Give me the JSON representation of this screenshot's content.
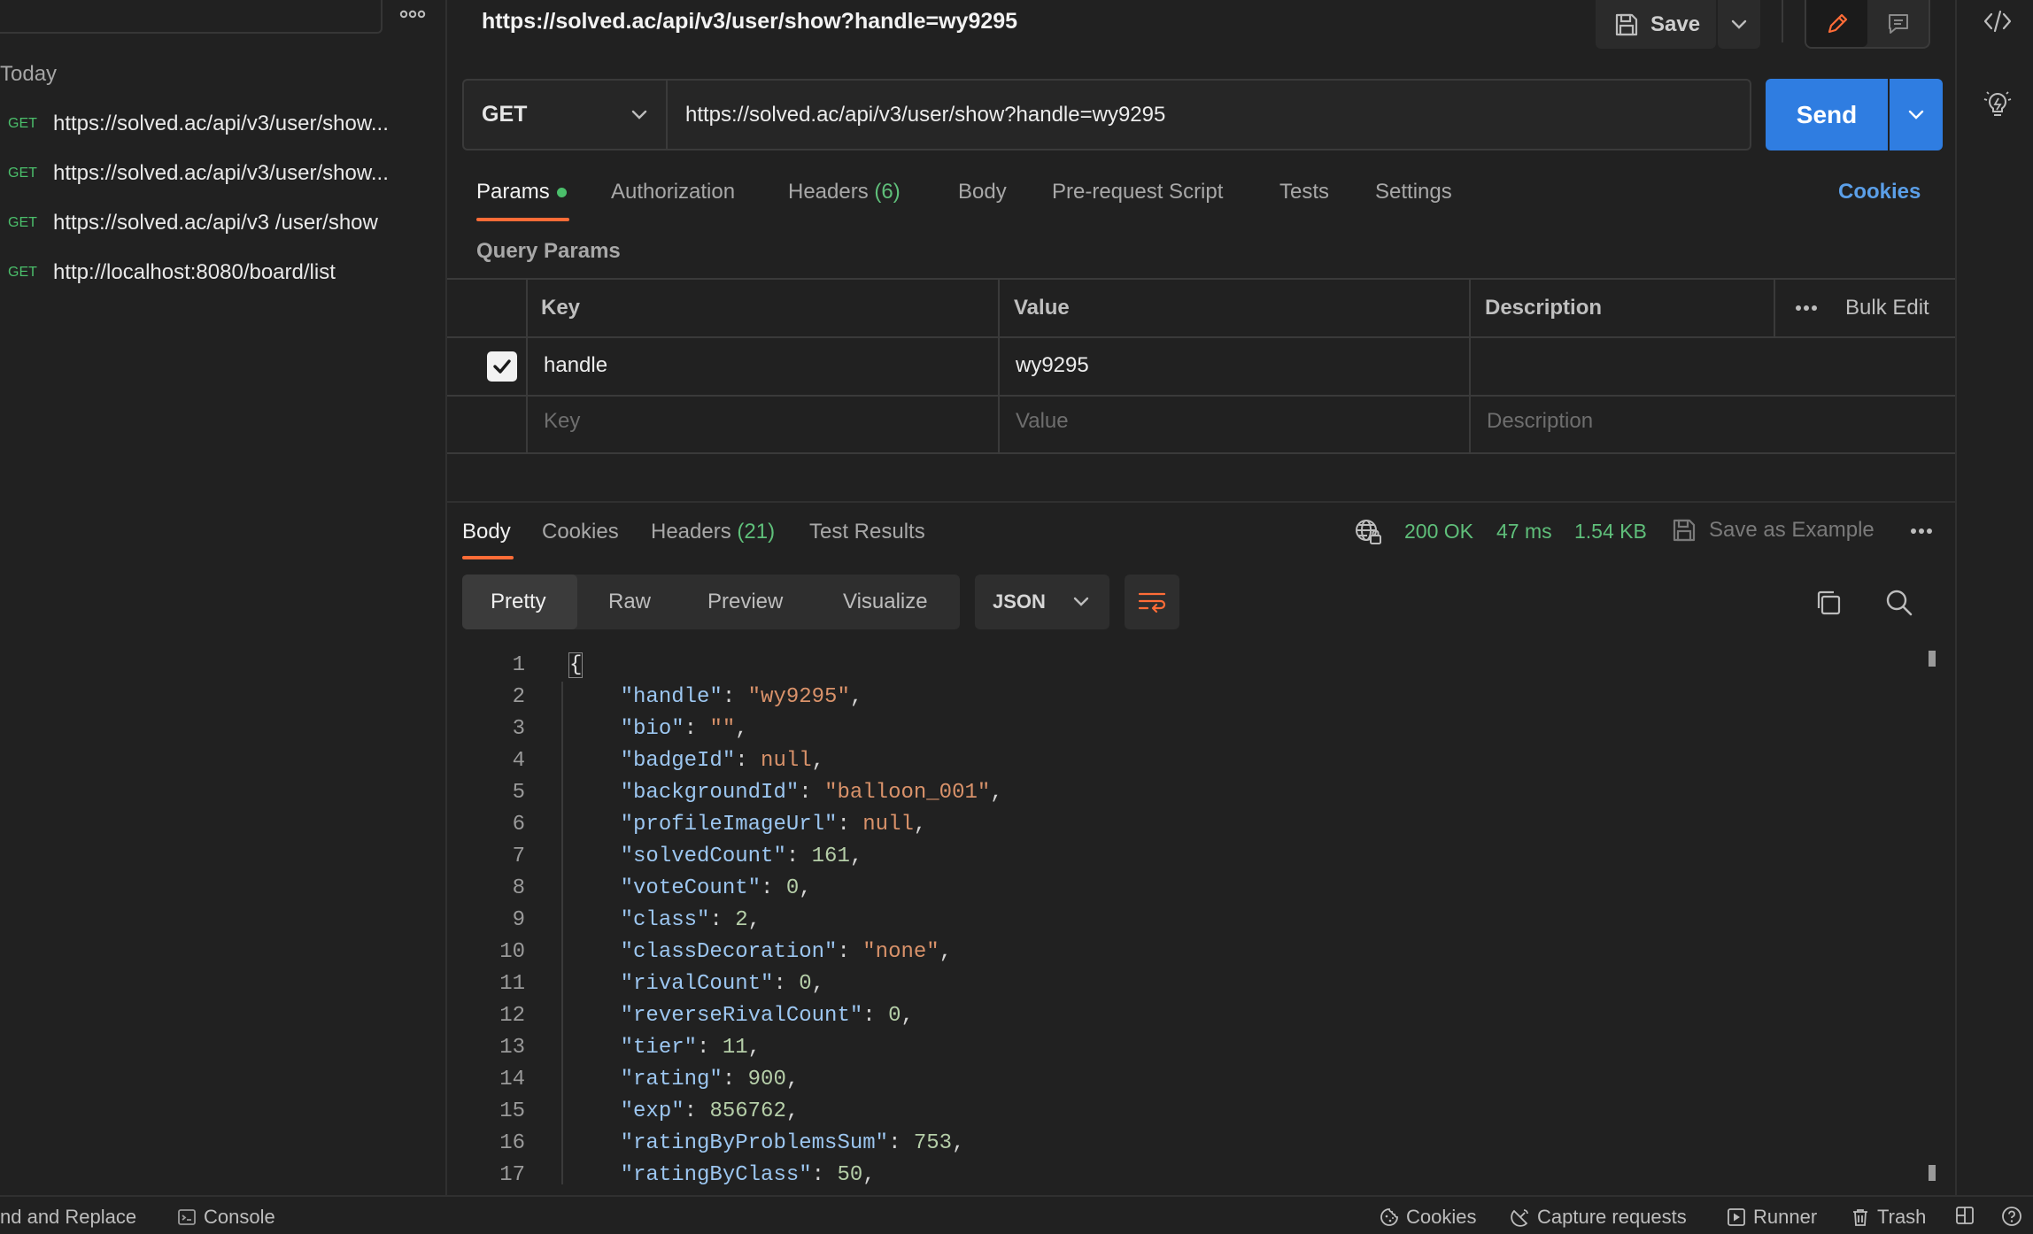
{
  "sidebar": {
    "group_label": "Today",
    "history": [
      {
        "method": "GET",
        "url": "https://solved.ac/api/v3/user/show..."
      },
      {
        "method": "GET",
        "url": "https://solved.ac/api/v3/user/show..."
      },
      {
        "method": "GET",
        "url": "https://solved.ac/api/v3 /user/show"
      },
      {
        "method": "GET",
        "url": "http://localhost:8080/board/list"
      }
    ]
  },
  "header": {
    "title": "https://solved.ac/api/v3/user/show?handle=wy9295",
    "save_label": "Save"
  },
  "request": {
    "method": "GET",
    "url": "https://solved.ac/api/v3/user/show?handle=wy9295",
    "send_label": "Send",
    "tabs": {
      "params": "Params",
      "authorization": "Authorization",
      "headers": "Headers",
      "headers_count": "(6)",
      "body": "Body",
      "prerequest": "Pre-request Script",
      "tests": "Tests",
      "settings": "Settings"
    },
    "cookies_link": "Cookies",
    "query_params_title": "Query Params",
    "table": {
      "col_key": "Key",
      "col_value": "Value",
      "col_description": "Description",
      "bulk_edit": "Bulk Edit",
      "rows": [
        {
          "key": "handle",
          "value": "wy9295",
          "description": "",
          "enabled": true
        }
      ],
      "placeholder": {
        "key": "Key",
        "value": "Value",
        "description": "Description"
      }
    }
  },
  "response": {
    "tabs": {
      "body": "Body",
      "cookies": "Cookies",
      "headers": "Headers",
      "headers_count": "(21)",
      "test_results": "Test Results"
    },
    "status": "200 OK",
    "time": "47 ms",
    "size": "1.54 KB",
    "save_example": "Save as Example",
    "views": [
      "Pretty",
      "Raw",
      "Preview",
      "Visualize"
    ],
    "active_view": "Pretty",
    "format": "JSON",
    "lines": [
      {
        "n": "1",
        "text": "{"
      },
      {
        "n": "2",
        "key": "handle",
        "val": "\"wy9295\"",
        "type": "s"
      },
      {
        "n": "3",
        "key": "bio",
        "val": "\"\"",
        "type": "s"
      },
      {
        "n": "4",
        "key": "badgeId",
        "val": "null",
        "type": "s"
      },
      {
        "n": "5",
        "key": "backgroundId",
        "val": "\"balloon_001\"",
        "type": "s"
      },
      {
        "n": "6",
        "key": "profileImageUrl",
        "val": "null",
        "type": "s"
      },
      {
        "n": "7",
        "key": "solvedCount",
        "val": "161",
        "type": "n"
      },
      {
        "n": "8",
        "key": "voteCount",
        "val": "0",
        "type": "n"
      },
      {
        "n": "9",
        "key": "class",
        "val": "2",
        "type": "n"
      },
      {
        "n": "10",
        "key": "classDecoration",
        "val": "\"none\"",
        "type": "s"
      },
      {
        "n": "11",
        "key": "rivalCount",
        "val": "0",
        "type": "n"
      },
      {
        "n": "12",
        "key": "reverseRivalCount",
        "val": "0",
        "type": "n"
      },
      {
        "n": "13",
        "key": "tier",
        "val": "11",
        "type": "n"
      },
      {
        "n": "14",
        "key": "rating",
        "val": "900",
        "type": "n"
      },
      {
        "n": "15",
        "key": "exp",
        "val": "856762",
        "type": "n"
      },
      {
        "n": "16",
        "key": "ratingByProblemsSum",
        "val": "753",
        "type": "n"
      },
      {
        "n": "17",
        "key": "ratingByClass",
        "val": "50",
        "type": "n"
      }
    ]
  },
  "footer": {
    "find_replace": "nd and Replace",
    "console": "Console",
    "cookies": "Cookies",
    "capture": "Capture requests",
    "runner": "Runner",
    "trash": "Trash"
  },
  "colors": {
    "accent": "#ff6c37",
    "send": "#2f7de1",
    "ok": "#5fbf7a",
    "link": "#5b9fe8"
  }
}
